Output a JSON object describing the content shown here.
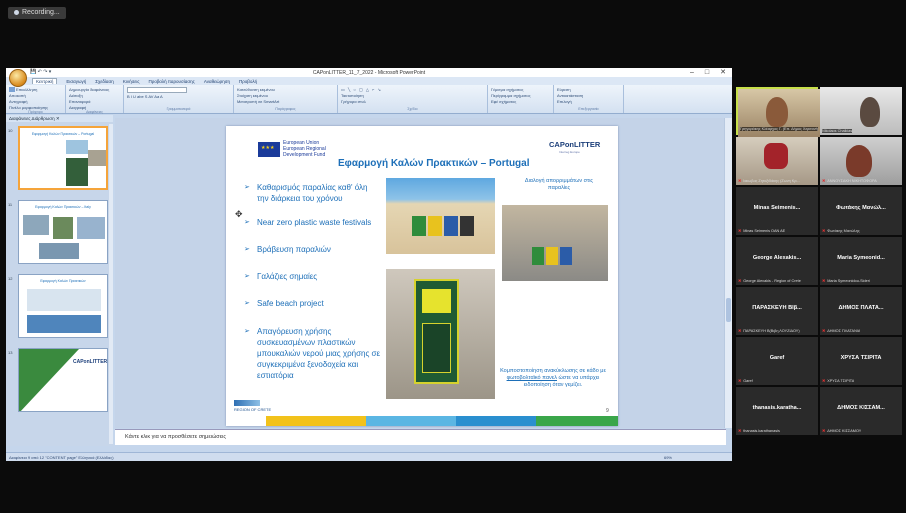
{
  "recording": {
    "label": "Recording..."
  },
  "window": {
    "title": "CAPonLITTER_11_7_2022 - Microsoft PowerPoint",
    "controls": [
      "–",
      "□",
      "✕"
    ]
  },
  "quick_access": {
    "label": "💾 ↶ ↷ ▾"
  },
  "ribbon": {
    "tabs": [
      "Κεντρική",
      "Εισαγωγή",
      "Σχεδίαση",
      "Κινήσεις",
      "Προβολή παρουσίασης",
      "Αναθεώρηση",
      "Προβολή"
    ],
    "groups": [
      {
        "name": "Πρόχειρο",
        "items": [
          "Επικόλληση",
          "Αποκοπή",
          "Αντιγραφή",
          "Πινέλο μορφοποίησης"
        ]
      },
      {
        "name": "Διαφάνειες",
        "items": [
          "Δημιουργία διαφάνειας",
          "Διάταξη",
          "Επαναφορά",
          "Διαγραφή"
        ]
      },
      {
        "name": "Γραμματοσειρά",
        "items": [
          "B  I  U  abe  S  AV  Aa  A"
        ]
      },
      {
        "name": "Παράγραφος",
        "items": [
          "Κατεύθυνση κειμένου",
          "Στοίχιση κειμένου",
          "Μετατροπή σε SmartArt"
        ]
      },
      {
        "name": "Σχέδιο",
        "items": [
          "Τακτοποίηση",
          "Γρήγορα στυλ",
          "Γέμισμα σχήματος",
          "Περίγραμμα σχήματος",
          "Εφέ σχήματος"
        ]
      },
      {
        "name": "Επεξεργασία",
        "items": [
          "Εύρεση",
          "Αντικατάσταση",
          "Επιλογή"
        ]
      }
    ]
  },
  "panel_tabs": {
    "label": "Διαφάνειες   Διάρθρωση   ✕"
  },
  "thumbnails": [
    {
      "number": "10",
      "title": "Εφαρμογή Καλών Πρακτικών – Portugal"
    },
    {
      "number": "11",
      "title": "Εφαρμογή Καλών Πρακτικών – Italy"
    },
    {
      "number": "12",
      "title": "Εφαρμογή Καλών Πρακτικών"
    },
    {
      "number": "13",
      "title": "CAPonLITTER"
    }
  ],
  "slide": {
    "eu_text": [
      "European Union",
      "European Regional",
      "Development Fund"
    ],
    "logo": "CAPonLITTER",
    "logo_sub": "Interreg Europe",
    "title": "Εφαρμογή Καλών Πρακτικών – Portugal",
    "bullets": [
      "Καθαρισμός παραλίας καθ' όλη την διάρκεια του χρόνου",
      "Near zero plastic waste festivals",
      "Βράβευση παραλιών",
      "Γαλάζιες σημαίες",
      "Safe beach project",
      "Απαγόρευση χρήσης συσκευασμένων πλαστικών μπουκαλιών νερού μιας χρήσης σε συγκεκριμένα ξενοδοχεία και εστιατόρια"
    ],
    "caption_top": "Διαλογή απορριμμάτων στις παραλίες",
    "caption_bottom_pre": "Κομποστοποίηση ανακύκλωσης σε κάδο με",
    "caption_bottom_link": "φωτοβολταϊκό πανελ",
    "caption_bottom_post": "ώστε να υπάρχει ειδοποίηση όταν γεμίζει.",
    "number": "9",
    "footer_logo": "REGION OF CRETE"
  },
  "notes": {
    "placeholder": "Κάντε κλικ για να προσθέσετε σημειώσεις"
  },
  "statusbar": {
    "text": "Διαφάνεια 9 από 12   \"CONTENT page\"   Ελληνικά (Ελλάδας)",
    "zoom": "69%"
  },
  "participants": [
    {
      "label": "Γρηγοράκης Κλέαρχος Γ. (Επ. Δήμος Χερσονήσου)",
      "video": true,
      "highlight": true
    },
    {
      "label": "Nikolaos Chalkias",
      "video": true
    },
    {
      "label": "Ιακωβος Ζητοξιδάκης (Ζωνη Κρ...",
      "video": true
    },
    {
      "label": "ΑΝΝΟΥΣΑΚΗ ΝΙΚΗΤΟΦΟΡΑ",
      "video": true
    },
    {
      "name": "Minas Seimenis...",
      "label": "Minas Seimenis OAN AE"
    },
    {
      "name": "Φωτάκης Μανώλ...",
      "label": "Φωτάκης Μανώλης"
    },
    {
      "name": "George Alexakis...",
      "label": "George Alexakis - Region of Crete"
    },
    {
      "name": "Maria Symeonid...",
      "label": "Maria Symeonidou-Sideri"
    },
    {
      "name": "ΠΑΡΑΣΚΕΥΗ ΒΙβ...",
      "label": "ΠΑΡΑΣΚΕΥΗ Β(Βιβη ΛΟΥΖΙΔΟΥ)"
    },
    {
      "name": "ΔΗΜΟΣ ΠΛΑΤΑ...",
      "label": "ΔΗΜΟΣ ΠΛΑΤΑΝΙΑ"
    },
    {
      "name": "Garef",
      "label": "Garef"
    },
    {
      "name": "ΧΡΥΣΑ ΤΣΙΡΙΤΑ",
      "label": "ΧΡΥΣΑ ΤΣΙΡΙΤΑ"
    },
    {
      "name": "thanasis.karatha...",
      "label": "thanasis.karathanasis"
    },
    {
      "name": "ΔΗΜΟΣ ΚΙΣΣΑΜ...",
      "label": "ΔΗΜΟΣ ΚΙΣΣΑΜΟΥ"
    }
  ],
  "colors": {
    "accent": "#1d6fb8",
    "ribbon": "#dce7f5",
    "mic_off": "#d33"
  }
}
